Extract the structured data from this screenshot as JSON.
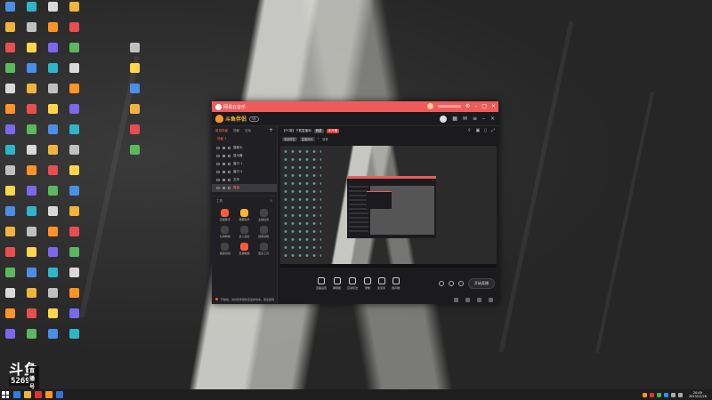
{
  "desktop": {
    "logo": {
      "big": "斗鱼",
      "tag": "直播号",
      "num": "52698"
    }
  },
  "window": {
    "title": "网易云音乐",
    "brand": "斗鱼伴侣",
    "brand_badge": "V5",
    "tabs": [
      "常用场景",
      "场景",
      "互动"
    ],
    "scene": "场景 1",
    "sources": [
      {
        "label": "摄像头"
      },
      {
        "label": "显示器"
      },
      {
        "label": "窗口 1"
      },
      {
        "label": "窗口 2"
      },
      {
        "label": "文本"
      },
      {
        "label": "屏幕"
      }
    ],
    "tools_header": "工具",
    "features": [
      {
        "label": "直播助手",
        "tone": "hot"
      },
      {
        "label": "弹幕助手",
        "tone": "warm"
      },
      {
        "label": "主播任务",
        "tone": ""
      },
      {
        "label": "礼物特效",
        "tone": ""
      },
      {
        "label": "多人连麦",
        "tone": ""
      },
      {
        "label": "视频剪辑",
        "tone": ""
      },
      {
        "label": "美颜滤镜",
        "tone": ""
      },
      {
        "label": "直播数据",
        "tone": "hot"
      },
      {
        "label": "更多工具",
        "tone": ""
      }
    ],
    "notice": "开播前，请将软件更新至最新版本，避免报错",
    "info": {
      "room": "【PC端】下载直播间",
      "tag1": "网游",
      "tag2": "未开播",
      "chips": [
        "英雄联盟",
        "直播房间"
      ],
      "red": "+",
      "extra": "分享"
    },
    "controls": [
      {
        "label": "直播设置"
      },
      {
        "label": "弹幕姬"
      },
      {
        "label": "互动玩法"
      },
      {
        "label": "录像"
      },
      {
        "label": "麦克风"
      },
      {
        "label": "扬声器"
      }
    ],
    "live_button": "开始直播"
  },
  "taskbar": {
    "time": "20:00",
    "date": "2023/12/26"
  },
  "colors": {
    "accent": "#ee5b5b",
    "brand": "#ffb530",
    "hot": "#ff5a3c"
  }
}
